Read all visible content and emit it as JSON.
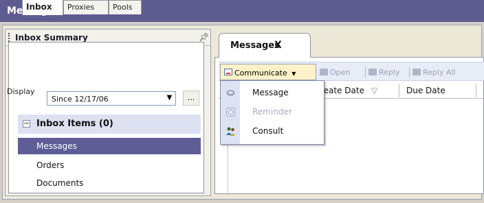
{
  "app": {
    "title": "Message Center"
  },
  "inbox_summary": {
    "title": "Inbox Summary",
    "pin_icon": "pin-icon",
    "tabs": [
      {
        "label": "Inbox",
        "active": true
      },
      {
        "label": "Proxies",
        "active": false
      },
      {
        "label": "Pools",
        "active": false
      }
    ],
    "display_label": "Display",
    "display_value": "Since  12/17/06",
    "more_button": "...",
    "group": {
      "title": "Inbox Items (0)",
      "items": [
        {
          "label": "Messages",
          "selected": true
        },
        {
          "label": "Orders",
          "selected": false
        },
        {
          "label": "Documents",
          "selected": false
        }
      ]
    }
  },
  "messages": {
    "tab_label": "Messages",
    "close_label": "X",
    "toolbar": {
      "communicate": "Communicate",
      "open": "Open",
      "reply": "Reply",
      "reply_all": "Reply All"
    },
    "columns": [
      "reate Date",
      "Due Date"
    ],
    "sort_icon": "▽"
  },
  "communicate_menu": {
    "items": [
      {
        "label": "Message",
        "icon": "message-icon",
        "enabled": true
      },
      {
        "label": "Reminder",
        "icon": "reminder-icon",
        "enabled": false
      },
      {
        "label": "Consult",
        "icon": "consult-icon",
        "enabled": true
      }
    ]
  },
  "colors": {
    "titlebar": "#5d5b8f",
    "selected_item": "#5e5d95",
    "group_header": "#dde1f2",
    "toolbar": "#e8ecf6",
    "communicate_button": "#fff2c8"
  }
}
